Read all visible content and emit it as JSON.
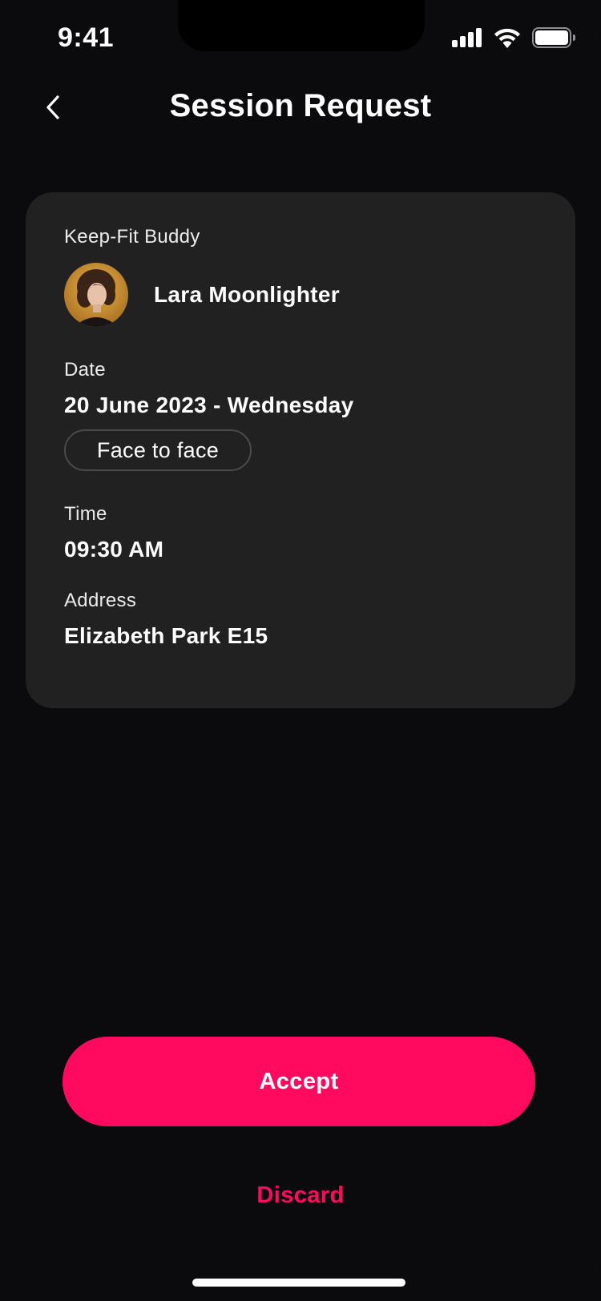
{
  "status_bar": {
    "time": "9:41",
    "icons": [
      "cellular-signal-icon",
      "wifi-icon",
      "battery-icon"
    ]
  },
  "header": {
    "back_icon": "chevron-left-icon",
    "title": "Session Request"
  },
  "request": {
    "buddy_label": "Keep-Fit Buddy",
    "buddy_name": "Lara Moonlighter",
    "date_label": "Date",
    "date_value": "20 June 2023 - Wednesday",
    "mode": "Face to face",
    "time_label": "Time",
    "time_value": "09:30 AM",
    "address_label": "Address",
    "address_value": "Elizabeth Park E15"
  },
  "actions": {
    "accept_label": "Accept",
    "discard_label": "Discard"
  },
  "colors": {
    "background": "#0b0b0d",
    "card": "#212122",
    "accent": "#ff0a5f",
    "text": "#ffffff"
  }
}
